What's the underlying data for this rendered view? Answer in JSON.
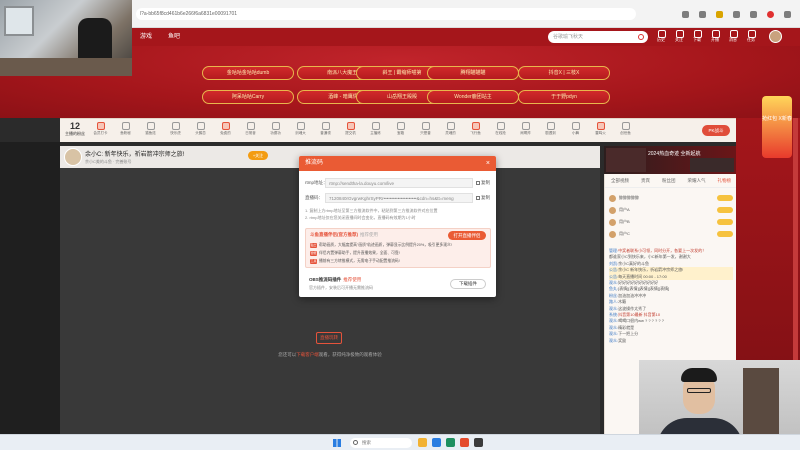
{
  "browser": {
    "url": "l?a-bb65f8cd461b6e266f6a6831e00091701",
    "toolbar_icons": [
      "refresh-icon",
      "zoom-icon",
      "favorite-star-icon",
      "collections-icon",
      "extensions-icon",
      "profile-icon",
      "more-icon"
    ]
  },
  "site": {
    "nav": [
      "分类",
      "游戏",
      "鱼吧"
    ],
    "search_placeholder": "谷歌瑜飞秋天",
    "header_icons": [
      "历史",
      "关注",
      "下载",
      "开播",
      "消息",
      "任务"
    ]
  },
  "banner": {
    "buttons": [
      "金咕咕金咕咕dumb",
      "南派八大魔王-",
      "斜王 | 霸缩师喵第",
      "腾翔瞄瞄瞄",
      "抖音X | 三枝X",
      "阿呆咕咕Carry",
      "酒峰 - 暗鹰情",
      "山岳翔王殿殿",
      "Wonder鹿团站主",
      "于于野pdyn"
    ]
  },
  "giftbar": {
    "count": "12",
    "count_label": "主播的粉丝",
    "items": [
      "会员打卡",
      "鱼粉秘",
      "猫鱼炫",
      "快乐虎",
      "头鹊恋",
      "免费的",
      "日常奋",
      "功德功",
      "剑魂大",
      "普通领",
      "提交机",
      "主播炼",
      "宝箱",
      "只是普",
      "灵魂的",
      "飞行鱼",
      "在线抢",
      "闹啊炸",
      "剧透到",
      "小舞",
      "雷鸣火",
      "创世鱼"
    ],
    "pk_label": "PK战斗"
  },
  "stream": {
    "title": "余小C: 新年快乐，祈岩箭冲宗师之旅!",
    "sub": "余小C美的斗鱼  · 完善账号",
    "follow_label": "+关注",
    "video_cta": "直播玩转",
    "video_hint_pre": "您还可以",
    "video_hint_link": "下载客户端",
    "video_hint_post": "观看，获得纯净极致的观看体验"
  },
  "side": {
    "banner_title": "2024热血奇迹 全新起航",
    "tabs": [
      "全部视频",
      "贵宾",
      "粉丝团",
      "荣耀人气",
      "礼物榜"
    ],
    "rank_rows": [
      "鲸鲸鲸鲸鲸",
      "用户A",
      "用户B",
      "用户C"
    ],
    "chat": [
      {
        "who": "管理:",
        "text": "中奖者联系小可领，同时分开，各要上一次发的！",
        "cls": "red"
      },
      {
        "who": "",
        "text": "都谁家小C到快乐来，小C新年第一发，谢谢大",
        "cls": ""
      },
      {
        "who": "刘凯:",
        "text": "余小C真好的斗鱼",
        "cls": ""
      },
      {
        "who": "公告:",
        "text": "余小C 新年快乐，祈岩箭冲宗师之旅!",
        "cls": "hl"
      },
      {
        "who": "公告:",
        "text": "每天直播时间 00:00 - 17:00",
        "cls": "hl"
      },
      {
        "who": "观众:",
        "text": "好好好好好好好好好好",
        "cls": ""
      },
      {
        "who": "鱼丸:",
        "text": "[表情][表情][表情][表情][表情]",
        "cls": ""
      },
      {
        "who": "粉丝:",
        "text": "加油加油冲冲冲",
        "cls": ""
      },
      {
        "who": "路人:",
        "text": "木籁",
        "cls": ""
      },
      {
        "who": "观众:",
        "text": "这波操作太秀了",
        "cls": ""
      },
      {
        "who": "系统:",
        "text": "抖音第10最新 抖音第10",
        "cls": "red"
      },
      {
        "who": "观众:",
        "text": "喝喝口很内ww ? ? ? ? ? ?",
        "cls": ""
      },
      {
        "who": "观众:",
        "text": "精彩就是",
        "cls": ""
      },
      {
        "who": "观众:",
        "text": "下一把上分",
        "cls": ""
      },
      {
        "who": "观众:",
        "text": "奖励",
        "cls": ""
      }
    ]
  },
  "promo_side": {
    "text": "抢红包 X新春"
  },
  "modal": {
    "title": "推流码",
    "rtmp_label": "rtmp地址：",
    "rtmp_value": "rtmp://sendtha-la.douyu.com/live",
    "key_label": "直播码：",
    "key_value": "7120840rGvgrwKghrSyPRr•••••••••••••••••••••&cdn=hs&tt=meng",
    "copy_label": "复制",
    "hint1": "1. 复制上方rtmp地址至第三方推流软件中，粘贴到第三方推流软件对应位置",
    "hint2": "2. rtmp地址仅在您关闭直播间时会变化，直播码有效期为1小时",
    "promo_title": "斗鱼直播伴侣(官方推荐)",
    "promo_tag": "推荐使用",
    "promo_btn": "打开直播伴侣",
    "promo_lines": [
      {
        "badge": "贴士",
        "text": "帮助画质，大幅度提高\"画质\"轨迹画质，弹幕显示比例提升20%，吸引更多观众!"
      },
      {
        "badge": "智能",
        "text": "伴侣内置弹幕助手，提升直播效果，全面、可靠!"
      },
      {
        "badge": "工具",
        "text": "播前有三方转推模式，无需电子手动配置推流码!"
      }
    ],
    "obs_title": "OBS推流码插件",
    "obs_tag": "推荐使用",
    "obs_desc": "官方插件，安装后可开播无需推流码",
    "download_label": "下载插件"
  },
  "taskbar": {
    "search_label": "搜索",
    "apps": [
      "#f2b233",
      "#2a7de1",
      "#1f8f5f",
      "#e44b2c",
      "#3b3b3b"
    ]
  }
}
